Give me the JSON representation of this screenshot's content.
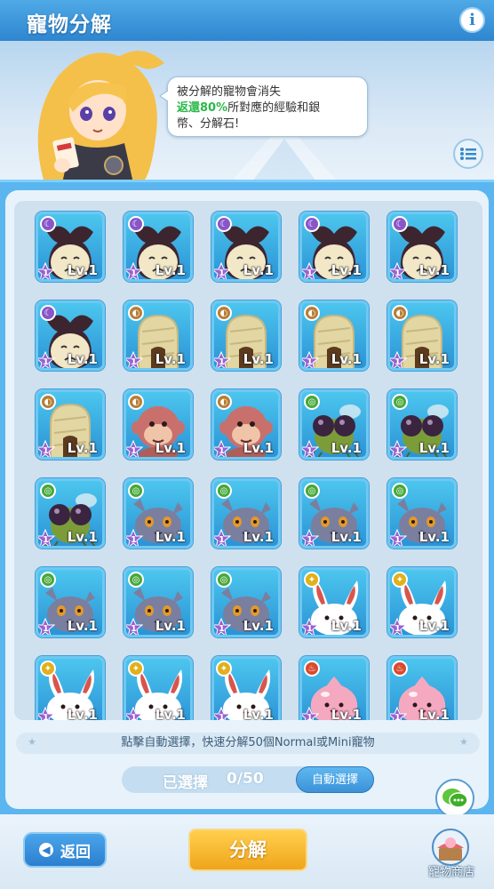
{
  "header": {
    "title": "寵物分解",
    "info_icon": "info-icon"
  },
  "banner": {
    "speech_line1": "被分解的寵物會消失",
    "speech_highlight": "返還80%",
    "speech_line2": "所對應的經驗和銀",
    "speech_line3": "幣、分解石!"
  },
  "pets": [
    {
      "type": "moon",
      "pet": "ghost",
      "star": "1",
      "level": "Lv.1"
    },
    {
      "type": "moon",
      "pet": "ghost",
      "star": "1",
      "level": "Lv.1"
    },
    {
      "type": "moon",
      "pet": "ghost",
      "star": "1",
      "level": "Lv.1"
    },
    {
      "type": "moon",
      "pet": "ghost",
      "star": "1",
      "level": "Lv.1"
    },
    {
      "type": "moon",
      "pet": "ghost",
      "star": "1",
      "level": "Lv.1"
    },
    {
      "type": "moon",
      "pet": "ghost",
      "star": "1",
      "level": "Lv.1"
    },
    {
      "type": "earth",
      "pet": "mummy",
      "star": "1",
      "level": "Lv.1"
    },
    {
      "type": "earth",
      "pet": "mummy",
      "star": "1",
      "level": "Lv.1"
    },
    {
      "type": "earth",
      "pet": "mummy",
      "star": "1",
      "level": "Lv.1"
    },
    {
      "type": "earth",
      "pet": "mummy",
      "star": "1",
      "level": "Lv.1"
    },
    {
      "type": "earth",
      "pet": "mummy",
      "star": "1",
      "level": "Lv.1"
    },
    {
      "type": "earth",
      "pet": "monkey",
      "star": "1",
      "level": "Lv.1"
    },
    {
      "type": "earth",
      "pet": "monkey",
      "star": "1",
      "level": "Lv.1"
    },
    {
      "type": "wind",
      "pet": "fly",
      "star": "1",
      "level": "Lv.1"
    },
    {
      "type": "wind",
      "pet": "fly",
      "star": "1",
      "level": "Lv.1"
    },
    {
      "type": "wind",
      "pet": "fly",
      "star": "1",
      "level": "Lv.1"
    },
    {
      "type": "wind",
      "pet": "cat",
      "star": "1",
      "level": "Lv.1"
    },
    {
      "type": "wind",
      "pet": "cat",
      "star": "1",
      "level": "Lv.1"
    },
    {
      "type": "wind",
      "pet": "cat",
      "star": "1",
      "level": "Lv.1"
    },
    {
      "type": "wind",
      "pet": "cat",
      "star": "1",
      "level": "Lv.1"
    },
    {
      "type": "wind",
      "pet": "cat",
      "star": "1",
      "level": "Lv.1"
    },
    {
      "type": "wind",
      "pet": "cat",
      "star": "1",
      "level": "Lv.1"
    },
    {
      "type": "wind",
      "pet": "cat",
      "star": "1",
      "level": "Lv.1"
    },
    {
      "type": "holy",
      "pet": "rabbit",
      "star": "1",
      "level": "Lv.1"
    },
    {
      "type": "holy",
      "pet": "rabbit",
      "star": "1",
      "level": "Lv.1"
    },
    {
      "type": "holy",
      "pet": "rabbit",
      "star": "1",
      "level": "Lv.1"
    },
    {
      "type": "holy",
      "pet": "rabbit",
      "star": "1",
      "level": "Lv.1"
    },
    {
      "type": "holy",
      "pet": "rabbit",
      "star": "1",
      "level": "Lv.1"
    },
    {
      "type": "fire",
      "pet": "poring",
      "star": "1",
      "level": "Lv.1"
    },
    {
      "type": "fire",
      "pet": "poring",
      "star": "1",
      "level": "Lv.1"
    }
  ],
  "hint": "點擊自動選擇，快速分解50個Normal或Mini寵物",
  "selection": {
    "label": "已選擇",
    "count": "0/50",
    "auto_label": "自動選擇"
  },
  "footer": {
    "back_label": "返回",
    "decompose_label": "分解",
    "shop_label": "寵物商店"
  }
}
